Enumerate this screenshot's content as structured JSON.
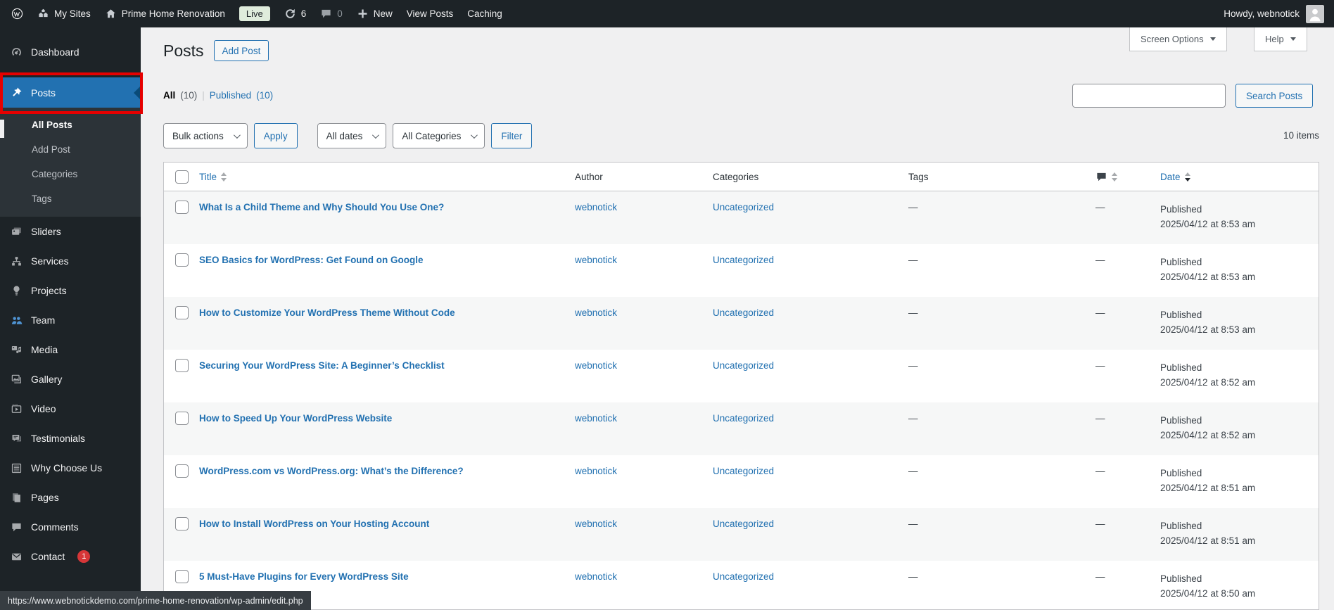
{
  "admin_bar": {
    "my_sites": "My Sites",
    "site_name": "Prime Home Renovation",
    "live_badge": "Live",
    "update_count": "6",
    "comment_count": "0",
    "new_label": "New",
    "view_posts": "View Posts",
    "caching": "Caching",
    "howdy": "Howdy, webnotick"
  },
  "sidebar": {
    "items": [
      {
        "slug": "dashboard",
        "label": "Dashboard",
        "icon": "dashboard-icon"
      },
      {
        "slug": "posts",
        "label": "Posts",
        "icon": "pin-icon",
        "selected": true,
        "submenu": [
          {
            "label": "All Posts",
            "current": true
          },
          {
            "label": "Add Post"
          },
          {
            "label": "Categories"
          },
          {
            "label": "Tags"
          }
        ]
      },
      {
        "slug": "sliders",
        "label": "Sliders",
        "icon": "sliders-icon"
      },
      {
        "slug": "services",
        "label": "Services",
        "icon": "services-icon"
      },
      {
        "slug": "projects",
        "label": "Projects",
        "icon": "projects-icon"
      },
      {
        "slug": "team",
        "label": "Team",
        "icon": "team-icon",
        "icon_color": "blue"
      },
      {
        "slug": "media",
        "label": "Media",
        "icon": "media-icon"
      },
      {
        "slug": "gallery",
        "label": "Gallery",
        "icon": "gallery-icon"
      },
      {
        "slug": "video",
        "label": "Video",
        "icon": "video-icon"
      },
      {
        "slug": "testimonials",
        "label": "Testimonials",
        "icon": "testimonials-icon"
      },
      {
        "slug": "why-choose-us",
        "label": "Why Choose Us",
        "icon": "list-icon"
      },
      {
        "slug": "pages",
        "label": "Pages",
        "icon": "pages-icon"
      },
      {
        "slug": "comments",
        "label": "Comments",
        "icon": "comments-icon"
      },
      {
        "slug": "contact",
        "label": "Contact",
        "icon": "envelope-icon",
        "badge": "1"
      }
    ]
  },
  "page": {
    "title": "Posts",
    "add_post": "Add Post",
    "screen_options": "Screen Options",
    "help": "Help",
    "views": {
      "all_label": "All",
      "all_count": "(10)",
      "separator": "|",
      "published_label": "Published",
      "published_count": "(10)"
    },
    "search_button": "Search Posts",
    "bulk_actions": "Bulk actions",
    "apply": "Apply",
    "all_dates": "All dates",
    "all_categories": "All Categories",
    "filter": "Filter",
    "items_count": "10 items"
  },
  "table": {
    "columns": {
      "title": "Title",
      "author": "Author",
      "categories": "Categories",
      "tags": "Tags",
      "date": "Date"
    },
    "rows": [
      {
        "title": "What Is a Child Theme and Why Should You Use One?",
        "author": "webnotick",
        "categories": "Uncategorized",
        "tags": "—",
        "comments": "—",
        "status": "Published",
        "date": "2025/04/12 at 8:53 am"
      },
      {
        "title": "SEO Basics for WordPress: Get Found on Google",
        "author": "webnotick",
        "categories": "Uncategorized",
        "tags": "—",
        "comments": "—",
        "status": "Published",
        "date": "2025/04/12 at 8:53 am"
      },
      {
        "title": "How to Customize Your WordPress Theme Without Code",
        "author": "webnotick",
        "categories": "Uncategorized",
        "tags": "—",
        "comments": "—",
        "status": "Published",
        "date": "2025/04/12 at 8:53 am"
      },
      {
        "title": "Securing Your WordPress Site: A Beginner’s Checklist",
        "author": "webnotick",
        "categories": "Uncategorized",
        "tags": "—",
        "comments": "—",
        "status": "Published",
        "date": "2025/04/12 at 8:52 am"
      },
      {
        "title": "How to Speed Up Your WordPress Website",
        "author": "webnotick",
        "categories": "Uncategorized",
        "tags": "—",
        "comments": "—",
        "status": "Published",
        "date": "2025/04/12 at 8:52 am"
      },
      {
        "title": "WordPress.com vs WordPress.org: What’s the Difference?",
        "author": "webnotick",
        "categories": "Uncategorized",
        "tags": "—",
        "comments": "—",
        "status": "Published",
        "date": "2025/04/12 at 8:51 am"
      },
      {
        "title": "How to Install WordPress on Your Hosting Account",
        "author": "webnotick",
        "categories": "Uncategorized",
        "tags": "—",
        "comments": "—",
        "status": "Published",
        "date": "2025/04/12 at 8:51 am"
      },
      {
        "title": "5 Must-Have Plugins for Every WordPress Site",
        "author": "webnotick",
        "categories": "Uncategorized",
        "tags": "—",
        "comments": "—",
        "status": "Published",
        "date": "2025/04/12 at 8:50 am"
      }
    ]
  },
  "status_bar": {
    "url": "https://www.webnotickdemo.com/prime-home-renovation/wp-admin/edit.php"
  },
  "icons": {
    "wordpress-logo": "circled W",
    "my-sites-icon": "house cluster",
    "home-icon": "house",
    "refresh-icon": "circular update arrows",
    "comment-bubble-icon": "speech bubble",
    "plus-icon": "plus",
    "user-avatar-icon": "person silhouette",
    "dashboard-icon": "gauge",
    "pin-icon": "pushpin",
    "sliders-icon": "stacked images",
    "services-icon": "sitemap",
    "projects-icon": "lightbulb",
    "team-icon": "people group",
    "media-icon": "camera and note",
    "gallery-icon": "framed photo stack",
    "video-icon": "film play frame",
    "testimonials-icon": "quote document",
    "list-icon": "lined list box",
    "pages-icon": "stacked pages",
    "comments-icon": "speech bubble",
    "envelope-icon": "envelope",
    "sort-arrows-icon": "up/down triangles",
    "chevron-down-icon": "thin chevron"
  },
  "colors": {
    "accent": "#2271b1",
    "admin_dark": "#1d2327",
    "submenu_bg": "#2c3338",
    "badge_red": "#d63638",
    "annotation_red": "#e60000",
    "live_badge_bg": "#dfecdc",
    "content_bg": "#f0f0f1",
    "row_stripe": "#f6f7f7",
    "table_border": "#c3c4c7"
  }
}
